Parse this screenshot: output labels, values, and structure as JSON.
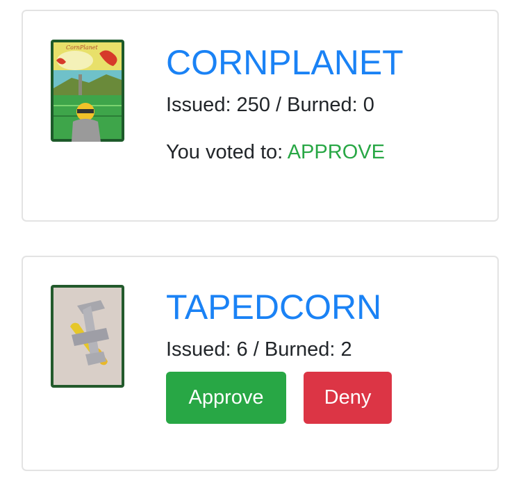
{
  "assets": [
    {
      "name": "CORNPLANET",
      "issued_label": "Issued:",
      "issued": "250",
      "burned_label": "Burned:",
      "burned": "0",
      "stats_text": "Issued: 250 / Burned: 0",
      "vote_prefix": "You voted to:",
      "vote_value": "APPROVE",
      "thumbnail_icon": "card-art-image"
    },
    {
      "name": "TAPEDCORN",
      "stats_text": "Issued: 6 / Burned: 2",
      "thumbnail_icon": "card-art-image",
      "approve_label": "Approve",
      "deny_label": "Deny"
    }
  ],
  "colors": {
    "link_blue": "#1a82f5",
    "approve_green": "#28a745",
    "deny_red": "#dc3545",
    "card_border": "#e3e3e3"
  }
}
